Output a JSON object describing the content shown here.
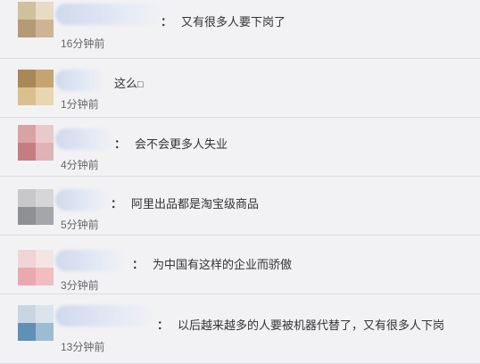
{
  "comments": [
    {
      "colon": "：",
      "text": "又有很多人要下岗了",
      "time": "16分钟前"
    },
    {
      "colon": "",
      "text": "这么",
      "time": "1分钟前"
    },
    {
      "colon": "：",
      "text": "会不会更多人失业",
      "time": "4分钟前"
    },
    {
      "colon": "：",
      "text": "阿里出品都是淘宝级商品",
      "time": "5分钟前"
    },
    {
      "colon": "：",
      "text": "为中国有这样的企业而骄傲",
      "time": "3分钟前"
    },
    {
      "colon": "：",
      "text": "以后越来越多的人要被机器代替了，又有很多人下岗",
      "time": "13分钟前"
    }
  ],
  "colors": {
    "background": "#f2f2f5",
    "divider": "#dcdce2",
    "comment_text": "#333333",
    "time_text": "#666666"
  }
}
